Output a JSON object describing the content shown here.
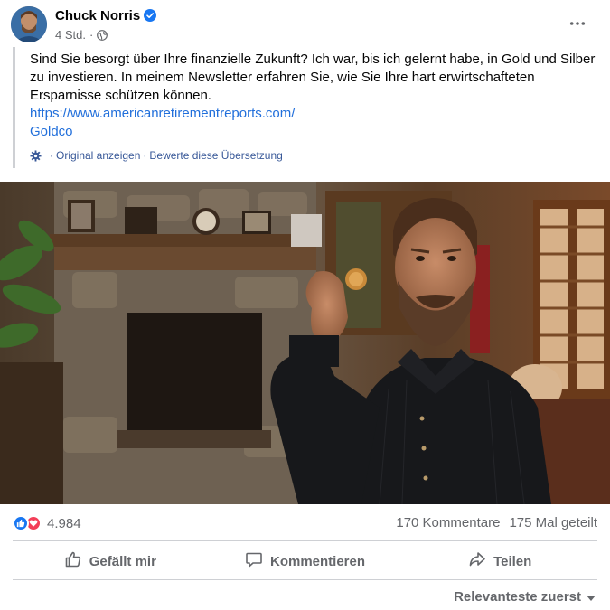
{
  "post": {
    "author": "Chuck Norris",
    "time": "4 Std.",
    "text": "Sind Sie besorgt über Ihre finanzielle Zukunft? Ich war, bis ich gelernt habe, in Gold und Silber zu investieren. In meinem Newsletter erfahren Sie, wie Sie Ihre hart erwirtschafteten Ersparnisse schützen können.",
    "link_url": "https://www.americanretirementreports.com/",
    "link_label": "Goldco",
    "show_original": "Original anzeigen",
    "rate_translation": "Bewerte diese Übersetzung",
    "separator": "·"
  },
  "stats": {
    "reactions": "4.984",
    "comments": "170 Kommentare",
    "shares": "175 Mal geteilt"
  },
  "actions": {
    "like": "Gefällt mir",
    "comment": "Kommentieren",
    "share": "Teilen"
  },
  "sort": {
    "label": "Relevanteste zuerst"
  },
  "icons": [
    "verified-icon",
    "globe-icon",
    "more-options-icon",
    "translate-gear-icon",
    "like-reaction-icon",
    "love-reaction-icon",
    "thumbs-up-icon",
    "comment-icon",
    "share-icon",
    "chevron-down-icon"
  ],
  "colors": {
    "link": "#216fdb",
    "secondary_text": "#65676b",
    "like_blue": "#1877f2",
    "love_red": "#f33e58"
  }
}
